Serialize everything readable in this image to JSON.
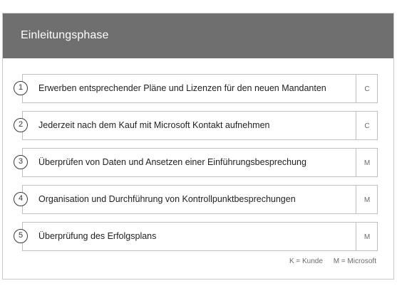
{
  "header": {
    "title": "Einleitungsphase"
  },
  "steps": [
    {
      "number": "1",
      "text": "Erwerben entsprechender Pläne und Lizenzen für den neuen Mandanten",
      "owner": "C"
    },
    {
      "number": "2",
      "text": "Jederzeit nach dem Kauf mit Microsoft Kontakt aufnehmen",
      "owner": "C"
    },
    {
      "number": "3",
      "text": "Überprüfen von Daten und Ansetzen einer Einführungsbesprechung",
      "owner": "M"
    },
    {
      "number": "4",
      "text": "Organisation und Durchführung von Kontrollpunktbesprechungen",
      "owner": "M"
    },
    {
      "number": "5",
      "text": "Überprüfung des Erfolgsplans",
      "owner": "M"
    }
  ],
  "legend": {
    "customer": "K = Kunde",
    "microsoft": "M = Microsoft"
  }
}
